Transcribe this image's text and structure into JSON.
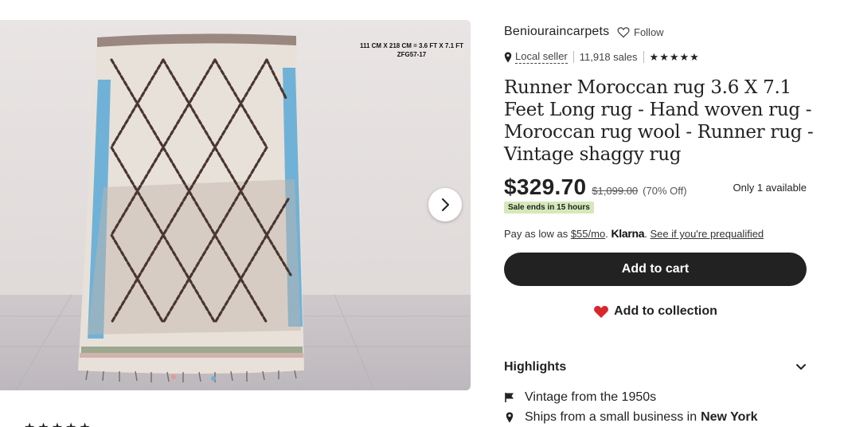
{
  "image": {
    "dimension_label_line1": "111 CM X 218 CM = 3.6 FT X 7.1 FT",
    "dimension_label_line2": "ZFG57-17"
  },
  "shop": {
    "name": "Beniouraincarpets",
    "follow_label": "Follow",
    "local_seller_label": "Local seller",
    "sales": "11,918 sales",
    "rating_stars": 5
  },
  "product": {
    "title": "Runner Moroccan rug 3.6 X 7.1 Feet Long rug - Hand woven rug - Moroccan rug wool - Runner rug - Vintage shaggy rug",
    "price": "$329.70",
    "original_price": "$1,099.00",
    "discount": "(70% Off)",
    "availability": "Only 1 available",
    "sale_badge": "Sale ends in 15 hours"
  },
  "klarna": {
    "prefix": "Pay as low as",
    "amount": "$55/mo",
    "dot1": ".",
    "logo": "Klarna",
    "dot2": ".",
    "link": "See if you're prequalified"
  },
  "actions": {
    "add_to_cart": "Add to cart",
    "add_to_collection": "Add to collection"
  },
  "highlights": {
    "heading": "Highlights",
    "items": [
      {
        "text": "Vintage from the 1950s",
        "strong": ""
      },
      {
        "text": "Ships from a small business in",
        "strong": "New York"
      }
    ]
  },
  "colors": {
    "primary_button": "#222222",
    "sale_badge_bg": "#d4e9b9",
    "heart": "#d8262c",
    "rug_accent_blue": "#5aa9d6"
  }
}
